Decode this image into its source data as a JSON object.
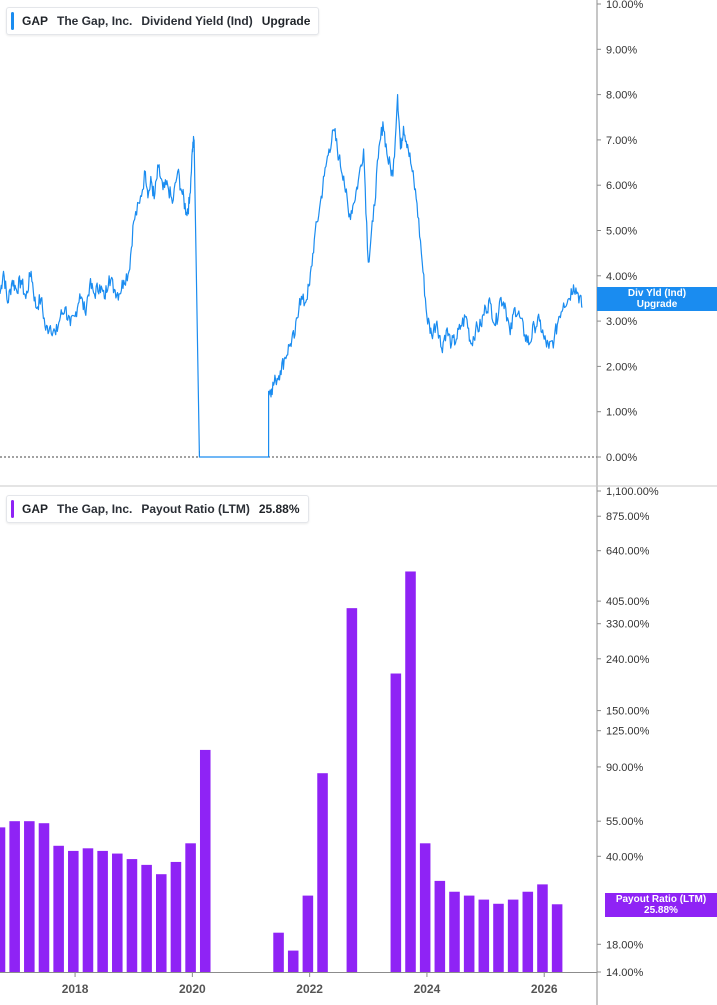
{
  "colors": {
    "yield_line": "#1a8cf0",
    "payout_bar": "#8f23f5",
    "zero_line": "#444444",
    "axis": "#8c8c8c"
  },
  "panel_top": {
    "legend": {
      "ticker": "GAP",
      "company": "The Gap, Inc.",
      "metric": "Dividend Yield (Ind)",
      "value": "Upgrade"
    },
    "axis_tag": {
      "line1": "Div Yld (Ind)",
      "line2": "Upgrade"
    }
  },
  "panel_bottom": {
    "legend": {
      "ticker": "GAP",
      "company": "The Gap, Inc.",
      "metric": "Payout Ratio (LTM)",
      "value": "25.88%"
    },
    "axis_tag": {
      "line1": "Payout Ratio (LTM)",
      "line2": "25.88%"
    }
  },
  "chart_data": [
    {
      "type": "line",
      "title": "Dividend Yield (Ind)",
      "y_ticks": [
        "0.00%",
        "1.00%",
        "2.00%",
        "3.00%",
        "4.00%",
        "5.00%",
        "6.00%",
        "7.00%",
        "8.00%",
        "9.00%",
        "10.00%"
      ],
      "ylim": [
        0,
        10
      ],
      "x_ticks": [
        "2018",
        "2020",
        "2022",
        "2024",
        "2026"
      ],
      "xlim": [
        2016.72,
        2026.9
      ],
      "series": [
        {
          "x": [
            2016.72,
            2016.78,
            2016.85,
            2016.93,
            2017.0,
            2017.08,
            2017.16,
            2017.25,
            2017.33,
            2017.42,
            2017.5,
            2017.58,
            2017.67,
            2017.75,
            2017.83,
            2017.92,
            2018.0,
            2018.08,
            2018.17,
            2018.25,
            2018.33,
            2018.42,
            2018.5,
            2018.58,
            2018.67,
            2018.75,
            2018.83,
            2018.92,
            2019.0,
            2019.1,
            2019.2,
            2019.25,
            2019.3,
            2019.35,
            2019.42,
            2019.5,
            2019.58,
            2019.66,
            2019.75,
            2019.83,
            2019.9,
            2019.95,
            2020.0,
            2020.03,
            2020.12,
            2020.12001,
            2021.3,
            2021.3001,
            2021.35,
            2021.42,
            2021.5,
            2021.58,
            2021.67,
            2021.75,
            2021.83,
            2021.92,
            2022.0,
            2022.08,
            2022.17,
            2022.25,
            2022.33,
            2022.42,
            2022.5,
            2022.58,
            2022.67,
            2022.75,
            2022.83,
            2022.92,
            2023.0,
            2023.08,
            2023.17,
            2023.25,
            2023.33,
            2023.42,
            2023.5,
            2023.55,
            2023.6,
            2023.67,
            2023.75,
            2023.83,
            2023.92,
            2024.0,
            2024.08,
            2024.17,
            2024.25,
            2024.33,
            2024.42,
            2024.5,
            2024.58,
            2024.67,
            2024.75,
            2024.83,
            2024.92,
            2025.0,
            2025.08,
            2025.17,
            2025.25,
            2025.33,
            2025.42,
            2025.5,
            2025.58,
            2025.67,
            2025.75,
            2025.83,
            2025.92,
            2026.0,
            2026.08,
            2026.17,
            2026.25,
            2026.33,
            2026.42,
            2026.5,
            2026.58,
            2026.65
          ],
          "y": [
            3.6,
            4.1,
            3.4,
            3.9,
            3.7,
            3.9,
            3.5,
            4.1,
            3.3,
            3.5,
            2.8,
            2.9,
            2.7,
            3.1,
            3.3,
            2.9,
            3.1,
            3.6,
            3.2,
            3.8,
            3.6,
            3.8,
            3.5,
            4.0,
            3.7,
            3.6,
            3.9,
            4.1,
            5.2,
            5.6,
            6.3,
            5.8,
            6.1,
            5.7,
            6.4,
            5.9,
            6.0,
            5.6,
            6.3,
            5.8,
            5.4,
            5.6,
            6.8,
            7.0,
            0.02,
            0.0,
            0.0,
            1.45,
            1.5,
            1.7,
            1.9,
            2.2,
            2.5,
            2.7,
            3.5,
            3.4,
            3.8,
            4.8,
            5.5,
            6.2,
            6.8,
            7.2,
            6.6,
            6.2,
            5.3,
            5.6,
            6.1,
            6.8,
            4.3,
            5.2,
            6.6,
            7.4,
            6.6,
            6.2,
            8.0,
            6.8,
            7.3,
            6.9,
            6.3,
            5.6,
            4.3,
            3.1,
            2.7,
            3.0,
            2.4,
            2.8,
            2.5,
            2.6,
            2.9,
            3.1,
            2.5,
            2.8,
            2.9,
            3.3,
            3.4,
            2.9,
            3.5,
            3.4,
            2.7,
            3.3,
            3.1,
            2.7,
            2.5,
            2.9,
            3.0,
            2.6,
            2.4,
            2.6,
            3.1,
            3.4,
            3.5,
            3.8,
            3.6,
            3.3
          ]
        }
      ]
    },
    {
      "type": "bar",
      "title": "Payout Ratio (LTM)",
      "y_scale": "log",
      "y_ticks": [
        "14.00%",
        "18.00%",
        "40.00%",
        "55.00%",
        "90.00%",
        "125.00%",
        "150.00%",
        "240.00%",
        "330.00%",
        "405.00%",
        "640.00%",
        "875.00%",
        "1,100.00%"
      ],
      "ylim": [
        14,
        1100
      ],
      "x_ticks": [
        "2018",
        "2020",
        "2022",
        "2024",
        "2026"
      ],
      "xlim": [
        2016.72,
        2026.9
      ],
      "x": [
        2016.72,
        2016.97,
        2017.22,
        2017.47,
        2017.72,
        2017.97,
        2018.22,
        2018.47,
        2018.72,
        2018.97,
        2019.22,
        2019.47,
        2019.72,
        2019.97,
        2020.22,
        2020.47,
        2020.72,
        2020.97,
        2021.22,
        2021.47,
        2021.72,
        2021.97,
        2022.22,
        2022.47,
        2022.72,
        2022.97,
        2023.22,
        2023.47,
        2023.72,
        2023.97,
        2024.22,
        2024.47,
        2024.72,
        2024.97,
        2025.22,
        2025.47,
        2025.72,
        2025.97,
        2026.22,
        2026.47
      ],
      "values": [
        52,
        55,
        55,
        54,
        44,
        42,
        43,
        42,
        41,
        39,
        37,
        34,
        38,
        45,
        105,
        null,
        null,
        null,
        null,
        20,
        17,
        28,
        85,
        null,
        380,
        null,
        null,
        210,
        530,
        45,
        32,
        29,
        28,
        27,
        26,
        27,
        29,
        31,
        25.88,
        null
      ]
    }
  ]
}
